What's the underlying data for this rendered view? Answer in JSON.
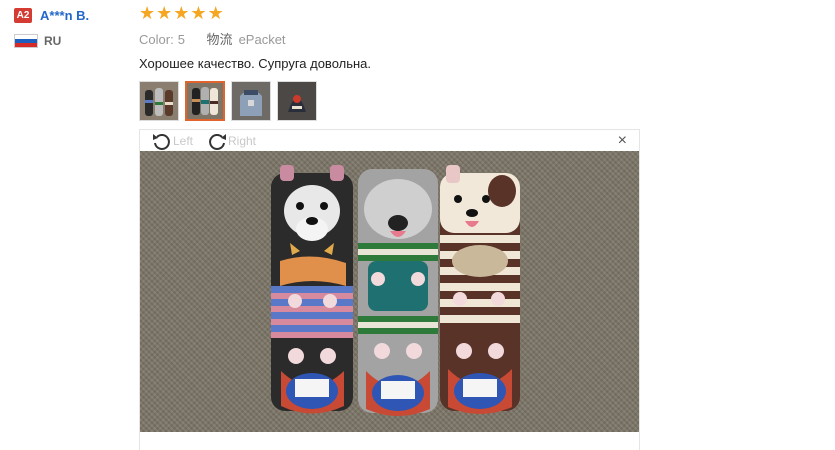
{
  "reviewer": {
    "avatar_text": "A2",
    "name": "A***n B.",
    "country": "RU",
    "flag_colors": [
      "#ffffff",
      "#1d5fbf",
      "#d62b2b"
    ]
  },
  "review": {
    "rating": 5,
    "color_label": "Color:",
    "color_value": "5",
    "shipping_label": "物流",
    "shipping_value": "ePacket",
    "text": "Хорошее качество. Супруга довольна."
  },
  "thumbnails": [
    {
      "name": "photo-1",
      "active": false
    },
    {
      "name": "photo-2",
      "active": true
    },
    {
      "name": "photo-3",
      "active": false
    },
    {
      "name": "photo-4",
      "active": false
    }
  ],
  "viewer": {
    "rotate_left_label": "Left",
    "rotate_right_label": "Right",
    "close_icon": "×"
  },
  "colors": {
    "accent": "#e0642b",
    "link": "#2267c9",
    "star": "#f5a623",
    "avatar_bg": "#d43c33"
  }
}
